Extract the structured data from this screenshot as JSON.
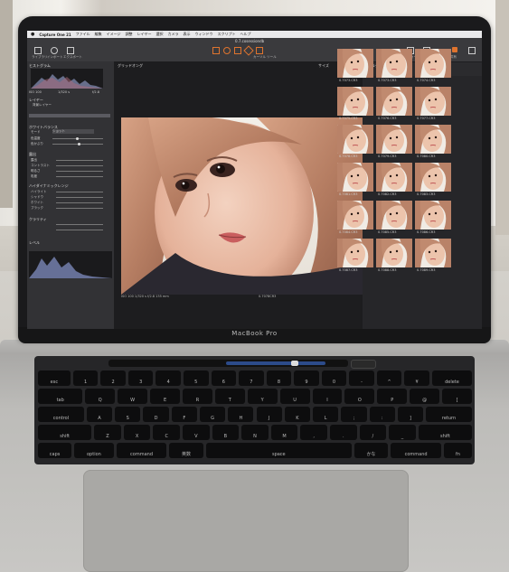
{
  "app": {
    "name": "Capture One 21",
    "menus": [
      "Capture One 21",
      "ファイル",
      "編集",
      "イメージ",
      "調整",
      "レイヤー",
      "選択",
      "カメラ",
      "表示",
      "ウィンドウ",
      "スクリプト",
      "ヘルプ"
    ],
    "window_title": "0.7.cosessiondb",
    "toolbar_left": [
      "ライブラリ",
      "インポート",
      "エクスポート"
    ],
    "toolbar_mid": "カーソル ツール",
    "toolbar_right": [
      "ビフォー",
      "グリッド",
      "オーバーレイ",
      "共有",
      "設定を貼付",
      "コピー/貼り付け"
    ],
    "counter": "1 - 992",
    "filter_label": "フィルタ",
    "size_label": "サイズ",
    "grid_label": "グリッドオング",
    "colors": {
      "accent": "#e0742e",
      "panel": "#323235",
      "viewer": "#1d1d1f"
    }
  },
  "left_panel": {
    "histogram_title": "ヒストグラム",
    "iso_readout": "ISO 100",
    "shutter_readout": "1/320 s",
    "fstop_readout": "f/2.8",
    "layers_title": "レイヤー",
    "layer_bg": "背景レイヤー",
    "white_balance_title": "ホワイトバランス",
    "wb_mode": "モード",
    "wb_mode_value": "ショット",
    "wb_temp": "色温度",
    "wb_tint": "色かぶり",
    "exposure_title": "露出",
    "exposure_rows": [
      "露出",
      "コントラスト",
      "明るさ",
      "彩度"
    ],
    "hdr_title": "ハイダイナミックレンジ",
    "hdr_rows": [
      "ハイライト",
      "シャドウ",
      "ホワイト",
      "ブラック"
    ],
    "clarity_title": "クラリティ",
    "levels_title": "レベル"
  },
  "viewer": {
    "caption_left": "ISO 100   1/320 s   f/2.8   135 mm",
    "caption_right": "0.7078CR3"
  },
  "thumbnails": [
    {
      "label": "0.7073.CR3"
    },
    {
      "label": "0.7073.CR3"
    },
    {
      "label": "0.7074.CR3"
    },
    {
      "label": "0.7075.CR3"
    },
    {
      "label": "0.7076.CR3"
    },
    {
      "label": "0.7077.CR3"
    },
    {
      "label": "0.7078.CR3"
    },
    {
      "label": "0.7079.CR3"
    },
    {
      "label": "0.7080.CR3"
    },
    {
      "label": "0.7081.CR3"
    },
    {
      "label": "0.7082.CR3"
    },
    {
      "label": "0.7083.CR3"
    },
    {
      "label": "0.7084.CR3"
    },
    {
      "label": "0.7085.CR3"
    },
    {
      "label": "0.7086.CR3"
    },
    {
      "label": "0.7087.CR3"
    },
    {
      "label": "0.7088.CR3"
    },
    {
      "label": "0.7089.CR3"
    }
  ],
  "laptop": {
    "brand": "MacBook Pro"
  },
  "keyboard": {
    "row1": [
      "esc",
      "1",
      "2",
      "3",
      "4",
      "5",
      "6",
      "7",
      "8",
      "9",
      "0",
      "-",
      "^",
      "¥",
      "delete"
    ],
    "row2": [
      "tab",
      "Q",
      "W",
      "E",
      "R",
      "T",
      "Y",
      "U",
      "I",
      "O",
      "P",
      "@",
      "["
    ],
    "row3": [
      "control",
      "A",
      "S",
      "D",
      "F",
      "G",
      "H",
      "J",
      "K",
      "L",
      ";",
      ":",
      "]",
      "return"
    ],
    "row4": [
      "shift",
      "Z",
      "X",
      "C",
      "V",
      "B",
      "N",
      "M",
      ",",
      ".",
      "/",
      "_",
      "shift"
    ],
    "row5": [
      "caps",
      "option",
      "command",
      "英数",
      "space",
      "かな",
      "command",
      "fn"
    ]
  }
}
